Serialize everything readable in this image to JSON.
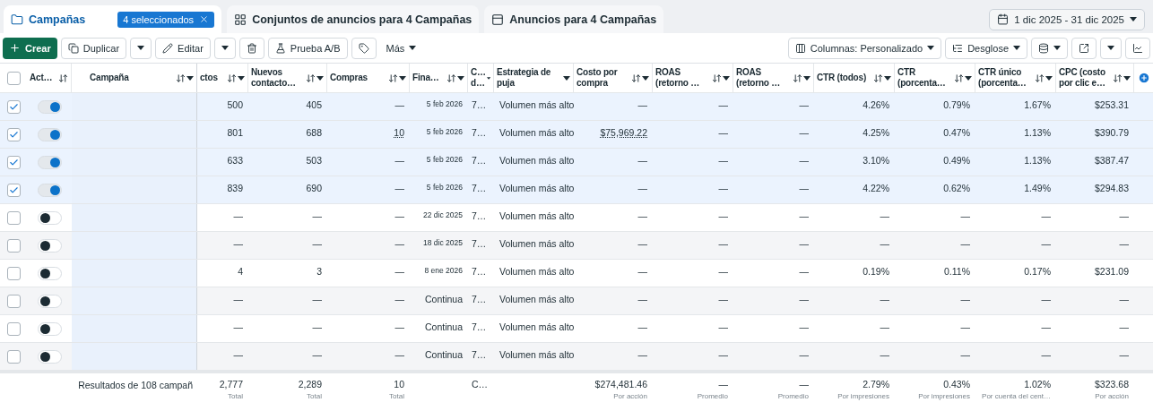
{
  "tabs": [
    {
      "label": "Campañas",
      "selected": true,
      "badge": "4 seleccionados"
    },
    {
      "label": "Conjuntos de anuncios para 4 Campañas",
      "selected": false
    },
    {
      "label": "Anuncios para 4 Campañas",
      "selected": false
    }
  ],
  "date_range": "1 dic 2025 - 31 dic 2025",
  "toolbar": {
    "create": "Crear",
    "duplicate": "Duplicar",
    "edit": "Editar",
    "ab_test": "Prueba A/B",
    "more": "Más",
    "columns": "Columnas: Personalizado",
    "breakdown": "Desglose"
  },
  "table": {
    "header_checkbox": {
      "checked": false
    },
    "frozen_columns": [
      {
        "label": "Act…",
        "sortable": true,
        "menu": false
      },
      {
        "label": "Campaña",
        "sortable": true,
        "menu": true
      }
    ],
    "columns": [
      {
        "label": "ctos",
        "sortable": true,
        "menu": true
      },
      {
        "label": "Nuevos contacto…",
        "sortable": true,
        "menu": true
      },
      {
        "label": "Compras",
        "sortable": true,
        "menu": true
      },
      {
        "label": "Fina…",
        "sortable": true,
        "menu": true
      },
      {
        "label": "C… d…",
        "sortable": false,
        "menu": true
      },
      {
        "label": "Estrategia de puja",
        "sortable": false,
        "menu": true
      },
      {
        "label": "Costo por compra",
        "sortable": true,
        "menu": true
      },
      {
        "label": "ROAS (retorno …",
        "sortable": true,
        "menu": true
      },
      {
        "label": "ROAS (retorno …",
        "sortable": true,
        "menu": true
      },
      {
        "label": "CTR (todos)",
        "sortable": true,
        "menu": true
      },
      {
        "label": "CTR (porcenta…",
        "sortable": true,
        "menu": true
      },
      {
        "label": "CTR único (porcenta…",
        "sortable": true,
        "menu": true
      },
      {
        "label": "CPC (costo por clic e…",
        "sortable": true,
        "menu": true
      }
    ],
    "rows": [
      {
        "selected": true,
        "on": true,
        "cells": [
          "500",
          "405",
          "—",
          {
            "text": "5 feb 2026",
            "kind": "date"
          },
          "7…",
          "Volumen más alto",
          "—",
          "—",
          "—",
          "4.26%",
          "0.79%",
          "1.67%",
          "$253.31"
        ]
      },
      {
        "selected": true,
        "on": true,
        "cells": [
          "801",
          "688",
          {
            "text": "10",
            "kind": "link"
          },
          {
            "text": "5 feb 2026",
            "kind": "date"
          },
          "7…",
          "Volumen más alto",
          {
            "text": "$75,969.22",
            "kind": "link"
          },
          "—",
          "—",
          "4.25%",
          "0.47%",
          "1.13%",
          "$390.79"
        ]
      },
      {
        "selected": true,
        "on": true,
        "cells": [
          "633",
          "503",
          "—",
          {
            "text": "5 feb 2026",
            "kind": "date"
          },
          "7…",
          "Volumen más alto",
          "—",
          "—",
          "—",
          "3.10%",
          "0.49%",
          "1.13%",
          "$387.47"
        ]
      },
      {
        "selected": true,
        "on": true,
        "cells": [
          "839",
          "690",
          "—",
          {
            "text": "5 feb 2026",
            "kind": "date"
          },
          "7…",
          "Volumen más alto",
          "—",
          "—",
          "—",
          "4.22%",
          "0.62%",
          "1.49%",
          "$294.83"
        ]
      },
      {
        "selected": false,
        "on": false,
        "cells": [
          "—",
          "—",
          "—",
          {
            "text": "22 dic 2025",
            "kind": "date"
          },
          "7…",
          "Volumen más alto",
          "—",
          "—",
          "—",
          "—",
          "—",
          "—",
          "—"
        ]
      },
      {
        "selected": false,
        "on": false,
        "cells": [
          "—",
          "—",
          "—",
          {
            "text": "18 dic 2025",
            "kind": "date"
          },
          "7…",
          "Volumen más alto",
          "—",
          "—",
          "—",
          "—",
          "—",
          "—",
          "—"
        ]
      },
      {
        "selected": false,
        "on": false,
        "cells": [
          "4",
          "3",
          "—",
          {
            "text": "8 ene 2026",
            "kind": "date"
          },
          "7…",
          "Volumen más alto",
          "—",
          "—",
          "—",
          "0.19%",
          "0.11%",
          "0.17%",
          "$231.09"
        ]
      },
      {
        "selected": false,
        "on": false,
        "cells": [
          "—",
          "—",
          "—",
          "Continua",
          "7…",
          "Volumen más alto",
          "—",
          "—",
          "—",
          "—",
          "—",
          "—",
          "—"
        ]
      },
      {
        "selected": false,
        "on": false,
        "cells": [
          "—",
          "—",
          "—",
          "Continua",
          "7…",
          "Volumen más alto",
          "—",
          "—",
          "—",
          "—",
          "—",
          "—",
          "—"
        ]
      },
      {
        "selected": false,
        "on": false,
        "cells": [
          "—",
          "—",
          "—",
          "Continua",
          "7…",
          "Volumen más alto",
          "—",
          "—",
          "—",
          "—",
          "—",
          "—",
          "—"
        ]
      }
    ],
    "footer": {
      "label": "Resultados de 108 campañ",
      "totals": [
        {
          "value": "2,777",
          "note": "Total"
        },
        {
          "value": "2,289",
          "note": "Total"
        },
        {
          "value": "10",
          "note": "Total"
        },
        {
          "value": "C…"
        },
        {
          "value": "$274,481.46",
          "note": "Por acción"
        },
        {
          "value": "—",
          "note": "Promedio"
        },
        {
          "value": "—",
          "note": "Promedio"
        },
        {
          "value": "2.79%",
          "note": "Por impresiones"
        },
        {
          "value": "0.43%",
          "note": "Por impresiones"
        },
        {
          "value": "1.02%",
          "note": "Por cuenta del cent…"
        },
        {
          "value": "$323.68",
          "note": "Por acción"
        }
      ]
    }
  }
}
